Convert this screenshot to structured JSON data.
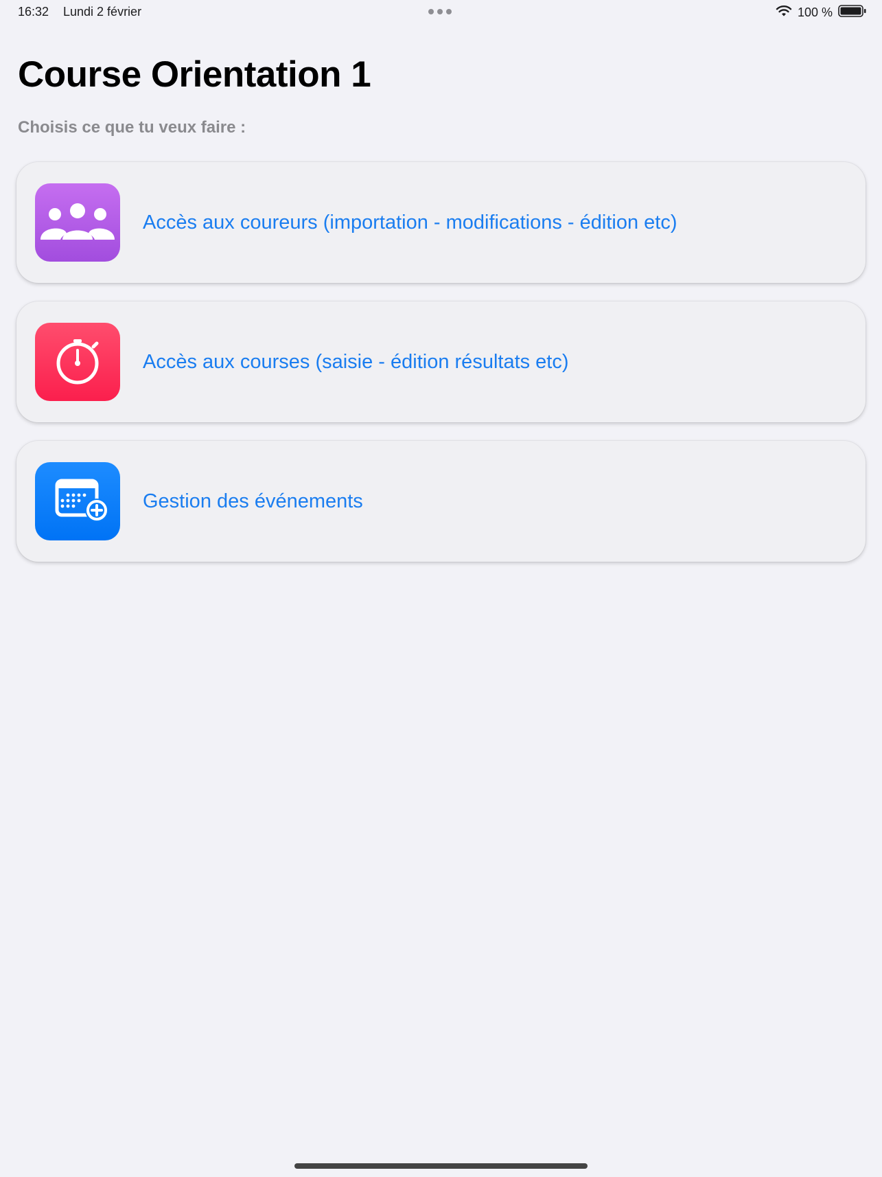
{
  "status_bar": {
    "time": "16:32",
    "date": "Lundi 2 février",
    "battery": "100 %"
  },
  "header": {
    "title": "Course Orientation 1",
    "subtitle": "Choisis ce que tu veux faire :"
  },
  "menu": {
    "items": [
      {
        "label": "Accès aux coureurs (importation - modifications - édition etc)",
        "icon": "people-group-icon",
        "color": "#b45be8"
      },
      {
        "label": "Accès aux courses (saisie - édition résultats etc)",
        "icon": "stopwatch-icon",
        "color": "#fd3459"
      },
      {
        "label": "Gestion des événements",
        "icon": "calendar-add-icon",
        "color": "#0a7ffa"
      }
    ]
  },
  "colors": {
    "background": "#f2f2f7",
    "link": "#1a7df0"
  }
}
